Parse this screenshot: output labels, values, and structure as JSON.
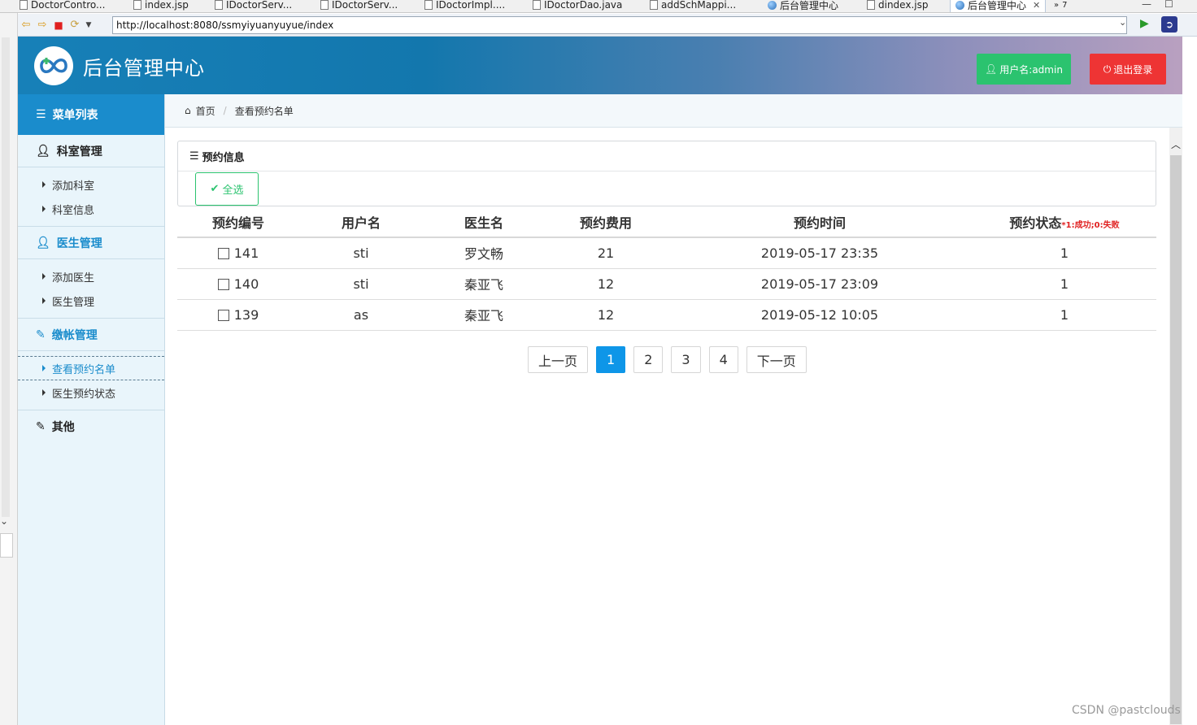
{
  "ide": {
    "tabs": [
      {
        "label": "DoctorContro...",
        "type": "file"
      },
      {
        "label": "index.jsp",
        "type": "file"
      },
      {
        "label": "IDoctorServ...",
        "type": "file"
      },
      {
        "label": "IDoctorServ...",
        "type": "file"
      },
      {
        "label": "IDoctorImpl....",
        "type": "file"
      },
      {
        "label": "IDoctorDao.java",
        "type": "file"
      },
      {
        "label": "addSchMappi...",
        "type": "file"
      },
      {
        "label": "后台管理中心",
        "type": "web"
      },
      {
        "label": "dindex.jsp",
        "type": "file"
      },
      {
        "label": "后台管理中心",
        "type": "web",
        "active": true
      }
    ],
    "overflow_count": "7"
  },
  "browser": {
    "url": "http://localhost:8080/ssmyiyuanyuyue/index"
  },
  "header": {
    "title": "后台管理中心",
    "user_label": "用户名:admin",
    "logout_label": "退出登录"
  },
  "sidebar": {
    "menu_title": "菜单列表",
    "sections": [
      {
        "label": "科室管理",
        "icon": "user-icon",
        "items": [
          "添加科室",
          "科室信息"
        ]
      },
      {
        "label": "医生管理",
        "icon": "user-icon",
        "items": [
          "添加医生",
          "医生管理"
        ]
      },
      {
        "label": "缴帐管理",
        "icon": "edit-icon",
        "items": [
          "查看预约名单",
          "医生预约状态"
        ]
      },
      {
        "label": "其他",
        "icon": "edit-icon",
        "items": []
      }
    ]
  },
  "breadcrumb": {
    "home": "首页",
    "current": "查看预约名单"
  },
  "panel": {
    "title": "预约信息",
    "select_all": "全选"
  },
  "table": {
    "headers": [
      "预约编号",
      "用户名",
      "医生名",
      "预约费用",
      "预约时间",
      "预约状态"
    ],
    "status_note": "*1:成功;0:失败",
    "rows": [
      {
        "id": "141",
        "user": "sti",
        "doctor": "罗文畅",
        "fee": "21",
        "time": "2019-05-17 23:35",
        "status": "1"
      },
      {
        "id": "140",
        "user": "sti",
        "doctor": "秦亚飞",
        "fee": "12",
        "time": "2019-05-17 23:09",
        "status": "1"
      },
      {
        "id": "139",
        "user": "as",
        "doctor": "秦亚飞",
        "fee": "12",
        "time": "2019-05-12 10:05",
        "status": "1"
      }
    ]
  },
  "pagination": {
    "prev": "上一页",
    "pages": [
      "1",
      "2",
      "3",
      "4"
    ],
    "current": "1",
    "next": "下一页"
  },
  "watermark": "CSDN @pastclouds",
  "colors": {
    "header_start": "#1780b8",
    "sidebar_head": "#1a8ccc",
    "success": "#2bc36f",
    "danger": "#ee3434",
    "page_active": "#0e96e8"
  }
}
